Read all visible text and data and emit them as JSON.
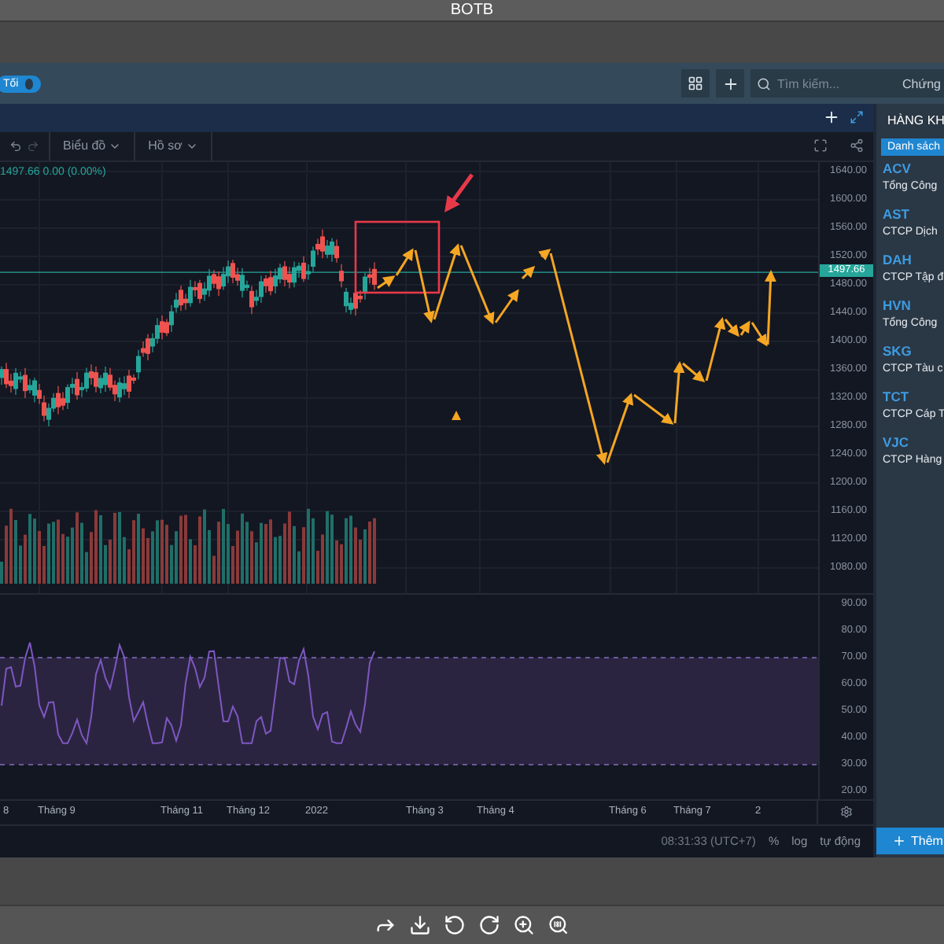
{
  "window": {
    "title": "BOTB"
  },
  "header": {
    "theme_toggle": {
      "label": "Tối",
      "on": true
    },
    "search": {
      "placeholder": "Tìm kiếm..."
    },
    "menu_label": "Chứng"
  },
  "chart_toolbar": {
    "menus": [
      {
        "label": "Biểu đồ"
      },
      {
        "label": "Hồ sơ"
      }
    ]
  },
  "legend": {
    "last": "1497.66",
    "change": "0.00 (0.00%)"
  },
  "price_axis": {
    "labels": [
      "1640.00",
      "1600.00",
      "1560.00",
      "1520.00",
      "1480.00",
      "1440.00",
      "1400.00",
      "1360.00",
      "1320.00",
      "1280.00",
      "1240.00",
      "1200.00",
      "1160.00",
      "1120.00",
      "1080.00"
    ],
    "current": "1497.66"
  },
  "rsi_axis": {
    "labels": [
      "90.00",
      "80.00",
      "70.00",
      "60.00",
      "50.00",
      "40.00",
      "30.00",
      "20.00"
    ]
  },
  "time_axis": {
    "labels": [
      "8",
      "Tháng 9",
      "Tháng 11",
      "Tháng 12",
      "2022",
      "Tháng 3",
      "Tháng 4",
      "Tháng 6",
      "Tháng 7",
      "2"
    ]
  },
  "footer": {
    "time": "08:31:33 (UTC+7)",
    "options": [
      "%",
      "log",
      "tự động"
    ]
  },
  "watchlist": {
    "title": "HÀNG KH",
    "tab": {
      "label": "Danh sách",
      "selected": true
    },
    "items": [
      {
        "symbol": "ACV",
        "name": "Tổng Công"
      },
      {
        "symbol": "AST",
        "name": "CTCP Dịch"
      },
      {
        "symbol": "DAH",
        "name": "CTCP Tập đ"
      },
      {
        "symbol": "HVN",
        "name": "Tổng Công"
      },
      {
        "symbol": "SKG",
        "name": "CTCP Tàu c"
      },
      {
        "symbol": "TCT",
        "name": "CTCP Cáp T"
      },
      {
        "symbol": "VJC",
        "name": "CTCP Hàng"
      }
    ],
    "add_button": "Thêm"
  }
}
